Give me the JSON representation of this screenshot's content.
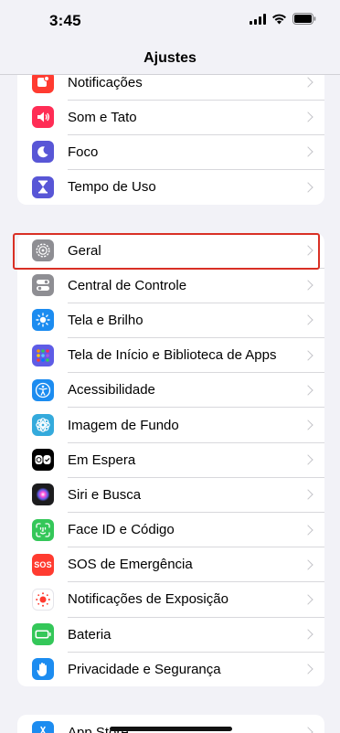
{
  "status": {
    "time": "3:45"
  },
  "nav": {
    "title": "Ajustes"
  },
  "group1": [
    {
      "label": "Notificações",
      "icon": "notifications-icon",
      "color": "#ff3b30"
    },
    {
      "label": "Som e Tato",
      "icon": "speaker-icon",
      "color": "#ff2d55"
    },
    {
      "label": "Foco",
      "icon": "moon-icon",
      "color": "#5856d6"
    },
    {
      "label": "Tempo de Uso",
      "icon": "hourglass-icon",
      "color": "#5856d6"
    }
  ],
  "group2": [
    {
      "label": "Geral",
      "icon": "gear-icon",
      "color": "#8e8e93"
    },
    {
      "label": "Central de Controle",
      "icon": "toggles-icon",
      "color": "#8e8e93"
    },
    {
      "label": "Tela e Brilho",
      "icon": "sun-icon",
      "color": "#1c8cf0"
    },
    {
      "label": "Tela de Início e Biblioteca de Apps",
      "icon": "app-grid-icon",
      "color": "#5e5ce6"
    },
    {
      "label": "Acessibilidade",
      "icon": "accessibility-icon",
      "color": "#1c8cf0"
    },
    {
      "label": "Imagem de Fundo",
      "icon": "flower-icon",
      "color": "#34aadc"
    },
    {
      "label": "Em Espera",
      "icon": "standby-icon",
      "color": "#000000"
    },
    {
      "label": "Siri e Busca",
      "icon": "siri-icon",
      "color": "#1c1c1e"
    },
    {
      "label": "Face ID e Código",
      "icon": "face-id-icon",
      "color": "#34c759"
    },
    {
      "label": "SOS de Emergência",
      "icon": "sos-icon",
      "color": "#ff3b30"
    },
    {
      "label": "Notificações de Exposição",
      "icon": "exposure-icon",
      "color": "#ffffff"
    },
    {
      "label": "Bateria",
      "icon": "battery-icon",
      "color": "#34c759"
    },
    {
      "label": "Privacidade e Segurança",
      "icon": "hand-icon",
      "color": "#1c8cf0"
    }
  ],
  "group3": [
    {
      "label": "App Store",
      "icon": "app-store-icon",
      "color": "#1c8cf0"
    }
  ],
  "icon_text": {
    "sos": "SOS"
  }
}
